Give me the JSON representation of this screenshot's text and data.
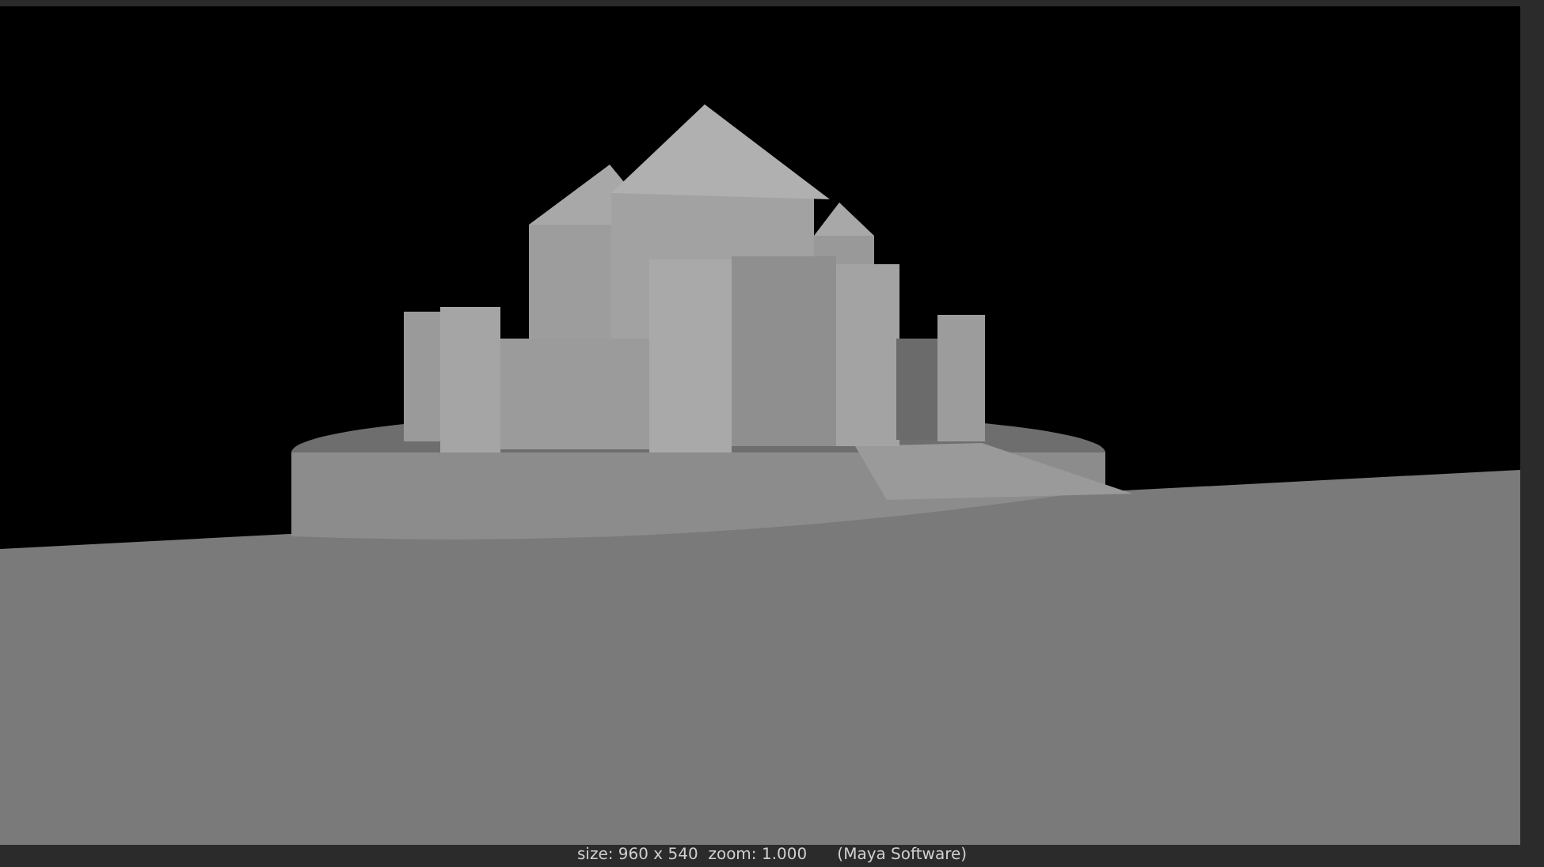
{
  "render_view": {
    "status": "size: 960 x 540  zoom: 1.000      (Maya Software)"
  }
}
